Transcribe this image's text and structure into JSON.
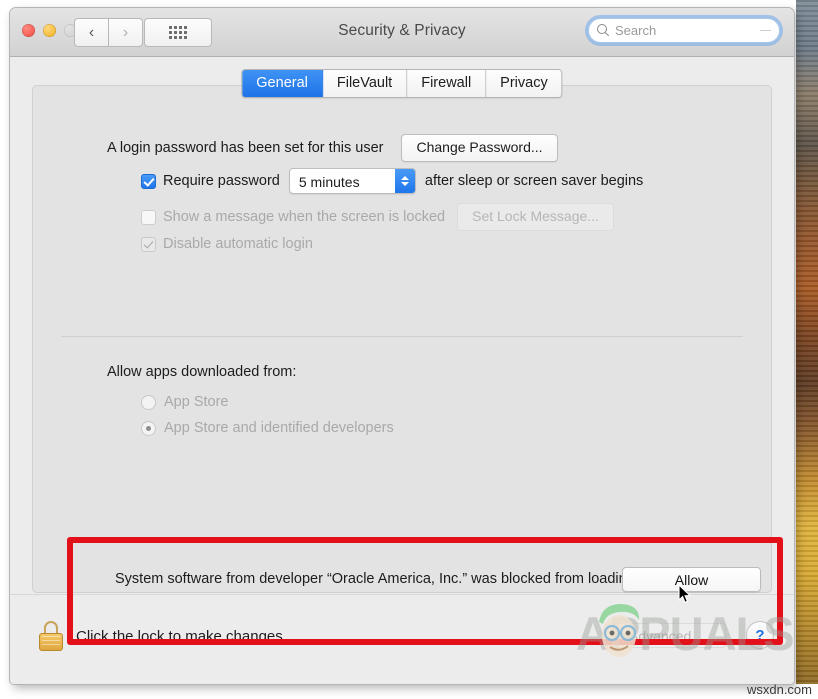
{
  "window": {
    "title": "Security & Privacy",
    "traffic_lights": [
      "close",
      "minimize",
      "zoom-disabled"
    ],
    "nav_back": "‹",
    "nav_forward": "›",
    "grid_button": "show-all-icon"
  },
  "search": {
    "placeholder": "Search",
    "value": "",
    "icon": "search-icon"
  },
  "tabs": [
    {
      "label": "General",
      "active": true
    },
    {
      "label": "FileVault",
      "active": false
    },
    {
      "label": "Firewall",
      "active": false
    },
    {
      "label": "Privacy",
      "active": false
    }
  ],
  "general": {
    "login_password_text": "A login password has been set for this user",
    "change_password_button": "Change Password...",
    "require_password": {
      "label_before": "Require password",
      "value": "5 minutes",
      "label_after": "after sleep or screen saver begins",
      "checked": true,
      "enabled": true
    },
    "show_message": {
      "label": "Show a message when the screen is locked",
      "button": "Set Lock Message...",
      "checked": false,
      "enabled": false
    },
    "disable_auto_login": {
      "label": "Disable automatic login",
      "checked": true,
      "enabled": false
    },
    "allow_apps_heading": "Allow apps downloaded from:",
    "allow_apps_options": [
      {
        "label": "App Store",
        "selected": false,
        "enabled": false
      },
      {
        "label": "App Store and identified developers",
        "selected": true,
        "enabled": false
      }
    ]
  },
  "blocked_notice": {
    "text": "System software from developer “Oracle America, Inc.” was blocked from loading.",
    "allow_button": "Allow",
    "highlight_color": "#e3101a"
  },
  "bottom": {
    "lock_icon": "padlock-closed-icon",
    "lock_text": "Click the lock to make changes.",
    "advanced_button": "Advanced...",
    "help_button": "?"
  },
  "watermark": {
    "brand": "APPUALS",
    "site": "wsxdn.com"
  },
  "colors": {
    "accent_blue": "#1f76ec",
    "highlight_red": "#e3101a",
    "window_bg": "#ececec",
    "panel_bg": "#e3e3e3"
  }
}
